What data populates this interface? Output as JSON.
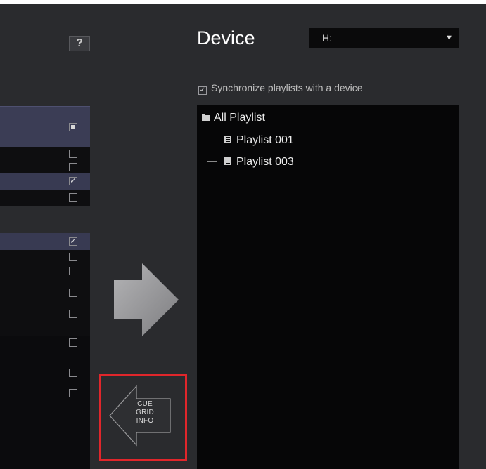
{
  "help": {
    "label": "?"
  },
  "device": {
    "title": "Device",
    "drive": "H:"
  },
  "sync": {
    "label": "Synchronize playlists with a device",
    "checked": true
  },
  "tree": {
    "root": "All Playlist",
    "items": [
      {
        "label": "Playlist 001"
      },
      {
        "label": "Playlist 003"
      }
    ]
  },
  "left_list": {
    "rows": [
      {
        "style": "header",
        "checked": "partial"
      },
      {
        "style": "dark",
        "checked": false
      },
      {
        "style": "dark",
        "checked": false
      },
      {
        "style": "sel",
        "checked": true
      },
      {
        "style": "dark",
        "checked": false
      },
      {
        "style": "sel",
        "checked": true
      },
      {
        "style": "dark",
        "checked": false
      },
      {
        "style": "dark",
        "checked": false
      },
      {
        "style": "dark",
        "checked": false
      },
      {
        "style": "dark",
        "checked": false
      },
      {
        "style": "dark",
        "checked": false
      },
      {
        "style": "dark",
        "checked": false
      }
    ]
  },
  "import_from_device": {
    "line1": "CUE",
    "line2": "GRID",
    "line3": "INFO"
  },
  "colors": {
    "background": "#2a2b2e",
    "highlight_border": "#e0262b",
    "selected_row": "#383a52"
  }
}
